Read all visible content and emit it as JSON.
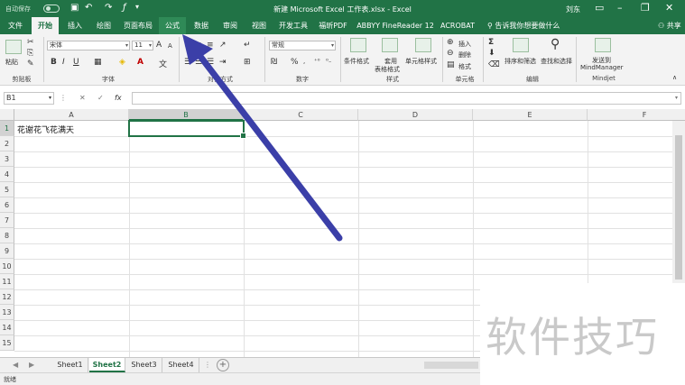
{
  "titlebar": {
    "autosave_label": "自动保存",
    "autosave_state": "关",
    "title": "新建 Microsoft Excel 工作表.xlsx  -  Excel",
    "user": "刘东",
    "icons": [
      "save-icon",
      "undo-icon",
      "redo-icon",
      "formula-icon"
    ],
    "color": "#217346"
  },
  "tabs": [
    {
      "label": "文件"
    },
    {
      "label": "开始"
    },
    {
      "label": "插入"
    },
    {
      "label": "绘图"
    },
    {
      "label": "页面布局"
    },
    {
      "label": "公式"
    },
    {
      "label": "数据"
    },
    {
      "label": "审阅"
    },
    {
      "label": "视图"
    },
    {
      "label": "开发工具"
    },
    {
      "label": "福昕PDF"
    },
    {
      "label": "ABBYY FineReader 12"
    },
    {
      "label": "ACROBAT"
    }
  ],
  "tellme": "告诉我你想要做什么",
  "share": "共享",
  "ribbon": {
    "paste": "粘贴",
    "clipboard": "剪贴板",
    "font_name": "宋体",
    "font_size": "11",
    "font": "字体",
    "alignment": "对齐方式",
    "number_format": "常规",
    "number": "数字",
    "conditional": "条件格式",
    "table_format_1": "套用",
    "table_format_2": "表格格式",
    "cell_style": "单元格样式",
    "styles": "样式",
    "insert": "插入",
    "delete": "删除",
    "format": "格式",
    "cells": "单元格",
    "sort_filter": "排序和筛选",
    "find_select": "查找和选择",
    "editing": "编辑",
    "mindmanager_1": "发送到",
    "mindmanager_2": "MindManager",
    "mindjet": "Mindjet",
    "bold": "B",
    "italic": "I",
    "underline": "U",
    "percent": "%",
    "sigma": "Σ",
    "grow_font": "A",
    "shrink_font": "A"
  },
  "formula_bar": {
    "name_box": "B1",
    "fx": "fx",
    "cancel": "✕",
    "enter": "✓",
    "content": ""
  },
  "grid": {
    "columns": [
      "A",
      "B",
      "C",
      "D",
      "E",
      "F"
    ],
    "rows": [
      "1",
      "2",
      "3",
      "4",
      "5",
      "6",
      "7",
      "8",
      "9",
      "10",
      "11",
      "12",
      "13",
      "14",
      "15"
    ],
    "cell_a1": "花谢花飞花满天",
    "selected_cell": "B1"
  },
  "sheets": [
    {
      "label": "Sheet1"
    },
    {
      "label": "Sheet2"
    },
    {
      "label": "Sheet3"
    },
    {
      "label": "Sheet4"
    }
  ],
  "status": "就绪",
  "watermark": "软件技巧",
  "arrow_color": "#3b3fa8"
}
